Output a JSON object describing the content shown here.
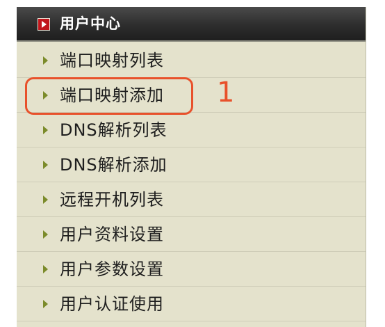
{
  "header": {
    "title": "用户中心",
    "icon": "play-square-icon"
  },
  "menu": {
    "items": [
      {
        "label": "端口映射列表"
      },
      {
        "label": "端口映射添加"
      },
      {
        "label": "DNS解析列表"
      },
      {
        "label": "DNS解析添加"
      },
      {
        "label": "远程开机列表"
      },
      {
        "label": "用户资料设置"
      },
      {
        "label": "用户参数设置"
      },
      {
        "label": "用户认证使用"
      }
    ]
  },
  "annotation": {
    "number": "1",
    "color": "#e8512b"
  },
  "colors": {
    "panel_bg": "#e4e2cc",
    "header_bg": "#2d2d2d",
    "arrow": "#7b8b2a",
    "header_icon": "#c1161c"
  }
}
